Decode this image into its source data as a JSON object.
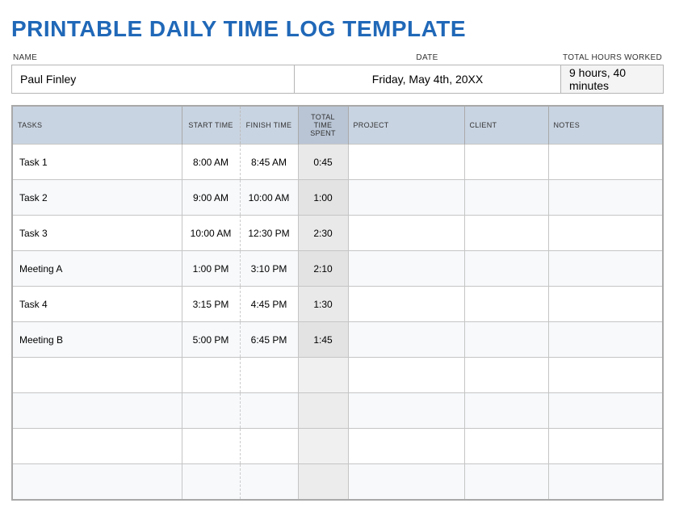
{
  "title": "PRINTABLE DAILY TIME LOG TEMPLATE",
  "labels": {
    "name": "NAME",
    "date": "DATE",
    "total_hours": "TOTAL HOURS WORKED"
  },
  "meta": {
    "name": "Paul Finley",
    "date": "Friday, May 4th, 20XX",
    "total_hours": "9 hours, 40 minutes"
  },
  "headers": {
    "tasks": "TASKS",
    "start": "START TIME",
    "finish": "FINISH TIME",
    "total_spent": "TOTAL TIME SPENT",
    "project": "PROJECT",
    "client": "CLIENT",
    "notes": "NOTES"
  },
  "rows": [
    {
      "task": "Task 1",
      "start": "8:00 AM",
      "finish": "8:45 AM",
      "total": "0:45",
      "project": "",
      "client": "",
      "notes": ""
    },
    {
      "task": "Task 2",
      "start": "9:00 AM",
      "finish": "10:00 AM",
      "total": "1:00",
      "project": "",
      "client": "",
      "notes": ""
    },
    {
      "task": "Task 3",
      "start": "10:00 AM",
      "finish": "12:30 PM",
      "total": "2:30",
      "project": "",
      "client": "",
      "notes": ""
    },
    {
      "task": "Meeting A",
      "start": "1:00 PM",
      "finish": "3:10 PM",
      "total": "2:10",
      "project": "",
      "client": "",
      "notes": ""
    },
    {
      "task": "Task 4",
      "start": "3:15 PM",
      "finish": "4:45 PM",
      "total": "1:30",
      "project": "",
      "client": "",
      "notes": ""
    },
    {
      "task": "Meeting B",
      "start": "5:00 PM",
      "finish": "6:45 PM",
      "total": "1:45",
      "project": "",
      "client": "",
      "notes": ""
    },
    {
      "task": "",
      "start": "",
      "finish": "",
      "total": "",
      "project": "",
      "client": "",
      "notes": ""
    },
    {
      "task": "",
      "start": "",
      "finish": "",
      "total": "",
      "project": "",
      "client": "",
      "notes": ""
    },
    {
      "task": "",
      "start": "",
      "finish": "",
      "total": "",
      "project": "",
      "client": "",
      "notes": ""
    },
    {
      "task": "",
      "start": "",
      "finish": "",
      "total": "",
      "project": "",
      "client": "",
      "notes": ""
    }
  ]
}
